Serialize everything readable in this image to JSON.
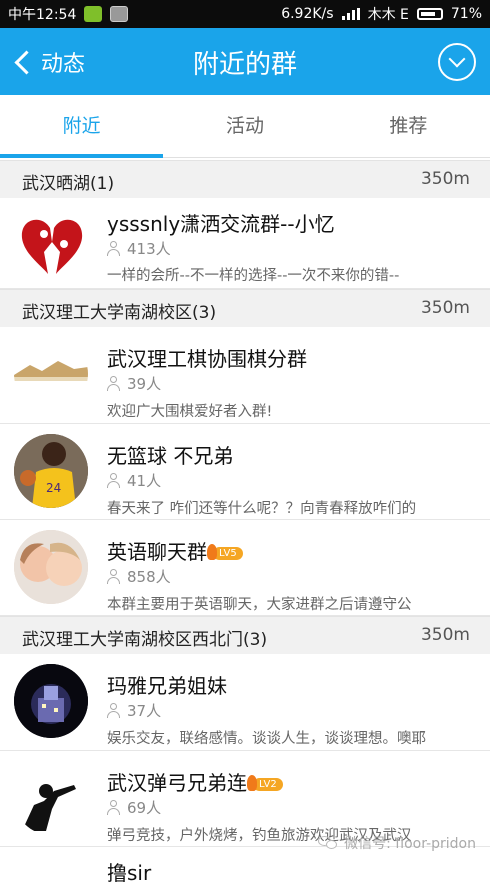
{
  "status_bar": {
    "time": "中午12:54",
    "speed": "6.92K/s",
    "carrier": "木木 E",
    "battery": "71%"
  },
  "header": {
    "back_label": "动态",
    "title": "附近的群"
  },
  "tabs": [
    {
      "label": "附近"
    },
    {
      "label": "活动"
    },
    {
      "label": "推荐"
    }
  ],
  "sections": [
    {
      "name": "武汉晒湖(1)",
      "distance": "350m",
      "groups": [
        {
          "name": "ysssnly潇洒交流群--小忆",
          "members": "413人",
          "desc": "一样的会所--不一样的选择--一次不来你的错--",
          "avatar": "broken-heart-avatar"
        }
      ]
    },
    {
      "name": "武汉理工大学南湖校区(3)",
      "distance": "350m",
      "groups": [
        {
          "name": "武汉理工棋协围棋分群",
          "members": "39人",
          "desc": "欢迎广大围棋爱好者入群!",
          "avatar": "landscape-avatar"
        },
        {
          "name": "无篮球  不兄弟",
          "members": "41人",
          "desc": "春天来了  咋们还等什么呢？？向青春释放咋们的",
          "avatar": "basketball-player-avatar"
        },
        {
          "name": "英语聊天群",
          "level": "LV5",
          "members": "858人",
          "desc": "本群主要用于英语聊天，大家进群之后请遵守公",
          "avatar": "children-avatar"
        }
      ]
    },
    {
      "name": "武汉理工大学南湖校区西北门(3)",
      "distance": "350m",
      "groups": [
        {
          "name": "玛雅兄弟姐妹",
          "members": "37人",
          "desc": "娱乐交友，联络感情。谈谈人生，谈谈理想。噢耶",
          "avatar": "night-city-avatar"
        },
        {
          "name": "武汉弹弓兄弟连",
          "level": "LV2",
          "members": "69人",
          "desc": "弹弓竞技，户外烧烤，钓鱼旅游欢迎武汉及武汉",
          "avatar": "slingshot-silhouette-avatar"
        },
        {
          "name": "撸sir",
          "members": "",
          "desc": "",
          "avatar": ""
        }
      ]
    }
  ],
  "watermark": {
    "text": "微信号: floor-pridon"
  }
}
